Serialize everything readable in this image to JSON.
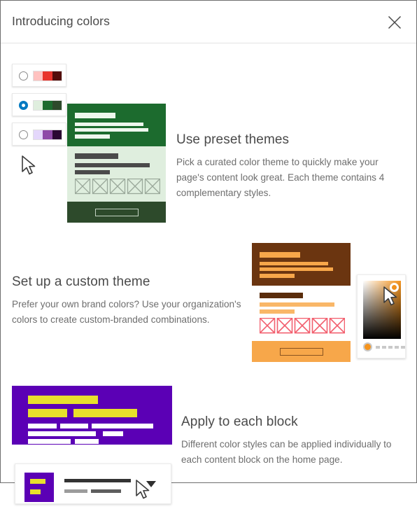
{
  "dialog": {
    "title": "Introducing colors",
    "close_label": "Close",
    "close_icon": "close-icon"
  },
  "sections": [
    {
      "id": "presets",
      "title": "Use preset themes",
      "description": "Pick a curated color theme to quickly make your page's content look great. Each theme contains 4 complementary styles.",
      "theme_options": [
        {
          "name": "red-theme",
          "selected": false,
          "swatch": [
            "#ffc2c0",
            "#e8342c",
            "#530c0a"
          ]
        },
        {
          "name": "green-theme",
          "selected": true,
          "swatch": [
            "#dfeede",
            "#1c6b2e",
            "#2d4a2b"
          ]
        },
        {
          "name": "purple-theme",
          "selected": false,
          "swatch": [
            "#e4d7fb",
            "#8e4aa8",
            "#2a0733"
          ]
        }
      ],
      "preview": {
        "name": "green-theme-page-preview",
        "header_bg": "#1c6b2e",
        "body_bg": "#dfeede",
        "footer_bg": "#2d4a2b",
        "accent_light": "#eef7ee",
        "text_dark": "#4a4a4a",
        "placeholder_stroke": "#9aa89a"
      }
    },
    {
      "id": "custom",
      "title": "Set up a custom theme",
      "description": "Prefer your own brand colors? Use your organization's colors to create custom-branded combinations.",
      "preview": {
        "name": "orange-theme-page-preview",
        "header_bg": "#6b3510",
        "body_bg": "#ffffff",
        "footer_bg": "#f5a council",
        "footer_color": "#f7a74a",
        "accent": "#f7a74a",
        "dark_bar": "#5a2d0c",
        "placeholder_stroke": "#f25f6e"
      },
      "color_picker": {
        "name": "color-picker",
        "selected_color": "#f0901c",
        "hue_color": "#f5941d",
        "gradient_from": "#ffffff",
        "gradient_to": "#f5941d"
      }
    },
    {
      "id": "blocks",
      "title": "Apply to each block",
      "description": "Different color styles can be applied individually to each content block on the home page.",
      "preview": {
        "name": "purple-block-preview",
        "bg": "#5b00b5",
        "accent": "#e8e02c",
        "text": "#ffffff"
      },
      "selector": {
        "name": "block-style-selector",
        "thumb_bg": "#5b00b5",
        "thumb_accent": "#e8e02c",
        "dropdown_icon": "chevron-down-icon"
      }
    }
  ],
  "colors": {
    "dialog_border": "#6e6e6e",
    "header_rule": "#e3e3e3",
    "title_text": "#4a4a4a",
    "body_text": "#6e6e6e",
    "radio_selected": "#0079c1"
  }
}
